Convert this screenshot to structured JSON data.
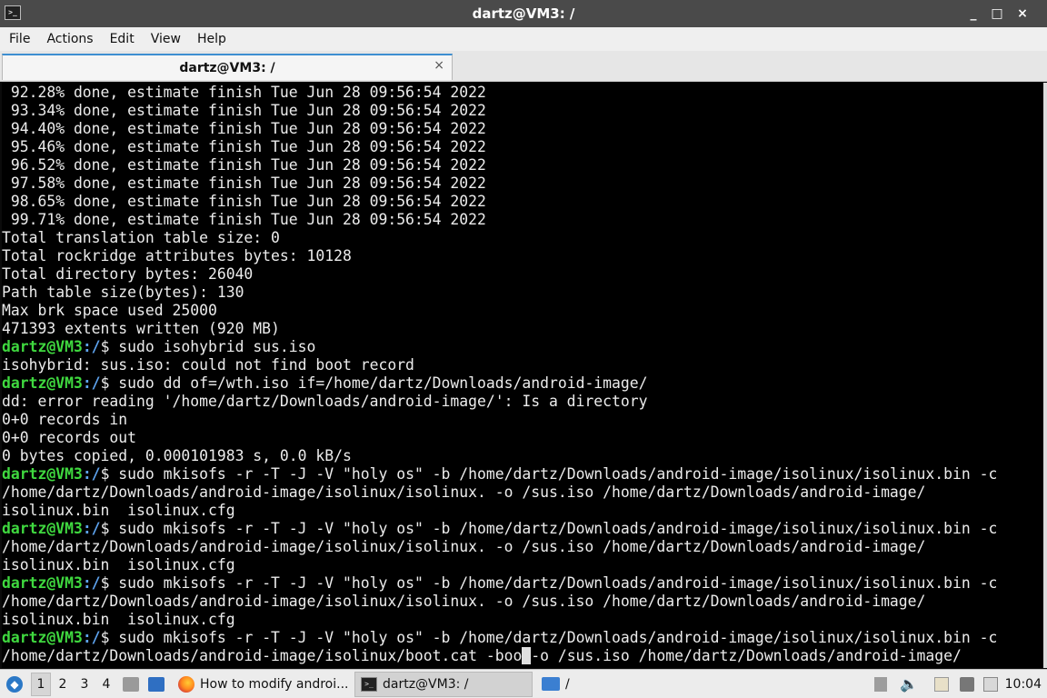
{
  "window": {
    "title": "dartz@VM3: /",
    "minimize_label": "_",
    "maximize_label": "□",
    "close_label": "×"
  },
  "menu": [
    "File",
    "Actions",
    "Edit",
    "View",
    "Help"
  ],
  "tab": {
    "title": "dartz@VM3: /",
    "close_label": "×"
  },
  "prompt": {
    "user": "dartz@VM3",
    "path": ":/",
    "symbol": "$"
  },
  "terminal_lines": [
    {
      "type": "out",
      "text": " 92.28% done, estimate finish Tue Jun 28 09:56:54 2022"
    },
    {
      "type": "out",
      "text": " 93.34% done, estimate finish Tue Jun 28 09:56:54 2022"
    },
    {
      "type": "out",
      "text": " 94.40% done, estimate finish Tue Jun 28 09:56:54 2022"
    },
    {
      "type": "out",
      "text": " 95.46% done, estimate finish Tue Jun 28 09:56:54 2022"
    },
    {
      "type": "out",
      "text": " 96.52% done, estimate finish Tue Jun 28 09:56:54 2022"
    },
    {
      "type": "out",
      "text": " 97.58% done, estimate finish Tue Jun 28 09:56:54 2022"
    },
    {
      "type": "out",
      "text": " 98.65% done, estimate finish Tue Jun 28 09:56:54 2022"
    },
    {
      "type": "out",
      "text": " 99.71% done, estimate finish Tue Jun 28 09:56:54 2022"
    },
    {
      "type": "out",
      "text": "Total translation table size: 0"
    },
    {
      "type": "out",
      "text": "Total rockridge attributes bytes: 10128"
    },
    {
      "type": "out",
      "text": "Total directory bytes: 26040"
    },
    {
      "type": "out",
      "text": "Path table size(bytes): 130"
    },
    {
      "type": "out",
      "text": "Max brk space used 25000"
    },
    {
      "type": "out",
      "text": "471393 extents written (920 MB)"
    },
    {
      "type": "cmd",
      "text": " sudo isohybrid sus.iso"
    },
    {
      "type": "out",
      "text": "isohybrid: sus.iso: could not find boot record"
    },
    {
      "type": "cmd",
      "text": " sudo dd of=/wth.iso if=/home/dartz/Downloads/android-image/"
    },
    {
      "type": "out",
      "text": "dd: error reading '/home/dartz/Downloads/android-image/': Is a directory"
    },
    {
      "type": "out",
      "text": "0+0 records in"
    },
    {
      "type": "out",
      "text": "0+0 records out"
    },
    {
      "type": "out",
      "text": "0 bytes copied, 0.000101983 s, 0.0 kB/s"
    },
    {
      "type": "cmd",
      "text": " sudo mkisofs -r -T -J -V \"holy os\" -b /home/dartz/Downloads/android-image/isolinux/isolinux.bin -c"
    },
    {
      "type": "out",
      "text": "/home/dartz/Downloads/android-image/isolinux/isolinux. -o /sus.iso /home/dartz/Downloads/android-image/"
    },
    {
      "type": "out",
      "text": "isolinux.bin  isolinux.cfg"
    },
    {
      "type": "cmd",
      "text": " sudo mkisofs -r -T -J -V \"holy os\" -b /home/dartz/Downloads/android-image/isolinux/isolinux.bin -c"
    },
    {
      "type": "out",
      "text": "/home/dartz/Downloads/android-image/isolinux/isolinux. -o /sus.iso /home/dartz/Downloads/android-image/"
    },
    {
      "type": "out",
      "text": "isolinux.bin  isolinux.cfg"
    },
    {
      "type": "cmd",
      "text": " sudo mkisofs -r -T -J -V \"holy os\" -b /home/dartz/Downloads/android-image/isolinux/isolinux.bin -c"
    },
    {
      "type": "out",
      "text": "/home/dartz/Downloads/android-image/isolinux/isolinux. -o /sus.iso /home/dartz/Downloads/android-image/"
    },
    {
      "type": "out",
      "text": "isolinux.bin  isolinux.cfg"
    },
    {
      "type": "cmd",
      "text": " sudo mkisofs -r -T -J -V \"holy os\" -b /home/dartz/Downloads/android-image/isolinux/isolinux.bin -c"
    }
  ],
  "current_input": {
    "before_cursor": "/home/dartz/Downloads/android-image/isolinux/boot.cat -boo",
    "at_cursor": " ",
    "after_cursor": "-o /sus.iso /home/dartz/Downloads/android-image/"
  },
  "taskbar": {
    "workspaces": [
      "1",
      "2",
      "3",
      "4"
    ],
    "active_workspace": "1",
    "tasks": [
      {
        "icon": "firefox-icon",
        "label": "How to modify androi..."
      },
      {
        "icon": "terminal-icon",
        "label": "dartz@VM3: /"
      },
      {
        "icon": "folder-icon",
        "label": "/"
      }
    ],
    "clock": "10:04"
  },
  "colors": {
    "prompt_user": "#3fd83f",
    "prompt_path": "#5ea4f0",
    "terminal_bg": "#000000",
    "terminal_fg": "#ececec",
    "titlebar_bg": "#4a4a4a",
    "tab_accent": "#3d8fd1"
  }
}
